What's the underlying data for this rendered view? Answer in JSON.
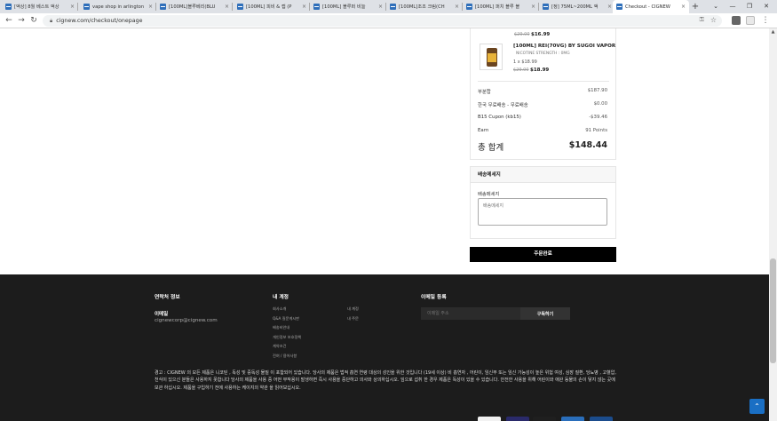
{
  "browser": {
    "tabs": [
      {
        "title": "[액상] 8월 베스트 액상"
      },
      {
        "title": "vape shop in arlington"
      },
      {
        "title": "[100ML]블루베리(BLU"
      },
      {
        "title": "[100ML] 피비 & 젭 (P"
      },
      {
        "title": "[100ML] 블루퍼 비늘 "
      },
      {
        "title": "[100ML]조조 크림(CH"
      },
      {
        "title": "[100ML] 퍼치 블루 블"
      },
      {
        "title": "[정] 75ML~200ML 액"
      },
      {
        "title": "Checkout - CIGNEW"
      }
    ],
    "new_tab": "+",
    "window_controls": [
      "⌄",
      "—",
      "❐",
      "✕"
    ],
    "url": "cignew.com/checkout/onepage"
  },
  "order_summary": {
    "item1": {
      "old_price": "$29.00",
      "price": "$16.99"
    },
    "item2": {
      "name": "[100ML] REI(70VG) BY SUGOI VAPOR",
      "meta": "NICOTINE STRENGTH : 0MG",
      "qty": "1 x $18.99",
      "old_price": "$29.00",
      "price": "$18.99"
    },
    "subtotal_label": "부분합",
    "subtotal_value": "$187.90",
    "shipping_label": "한국 무료배송 - 무료배송",
    "shipping_value": "$0.00",
    "coupon_label": "B15 Cupon (kb15)",
    "coupon_value": "-$39.46",
    "earn_label": "Earn",
    "earn_value": "91 Points",
    "total_label": "총 합계",
    "total_value": "$148.44"
  },
  "delivery_message": {
    "title": "배송메세지",
    "label": "배송메세지",
    "placeholder": "배송메세지"
  },
  "place_order_label": "주문완료",
  "footer": {
    "contact_title": "연락처 정보",
    "email_label": "이메일",
    "email_value": "cignewcorp@cignew.com",
    "account_title": "내 계정",
    "links_col1": [
      "회사소개",
      "Q&A 질문게시판",
      "배송비안내",
      "개인정보 보호정책",
      "계약조건",
      "전여 / 용어사항"
    ],
    "links_col2": [
      "내 계정",
      "내 주문"
    ],
    "newsletter_title": "이메일 등록",
    "newsletter_placeholder": "이메일 주소",
    "newsletter_button": "구독하기",
    "warning": "경고 : CIGNEW 의 모든 제품은 니코틴 , 독성 및 중독성 물질 이 포함되어 있습니다. 당사의 제품은 법적 흡연 연령 대상의 성인을 위한 것입니다 (19세 이상) 비 흡연자 , 어린이, 임신부 또는 임신 가능성이 높은 위험 여성, 심장 질환, 당뇨병 , 고혈압, 천식이 있으신 분들은 사용하지 못합니다 당사의 제품을 사용 중 어떤 부작용이 발생하면 즉시 사용을 중단하고 의사와 상의하십시오. 잎으로 섭취 한 경우 제품은 독성이 있을 수 있습니다. 안전한 사용을 위해 어린이와 애완 동물의 손이 닿지 않는 곳에 보관 하십시오. 제품을 구입하기 전에 사용하는 케이지의 약관 을 읽어보십시오."
  },
  "colors": {
    "accent": "#000000",
    "footer_bg": "#1c1c1c",
    "to_top": "#1a6fc4",
    "tab_bar": "#dee1e6"
  }
}
